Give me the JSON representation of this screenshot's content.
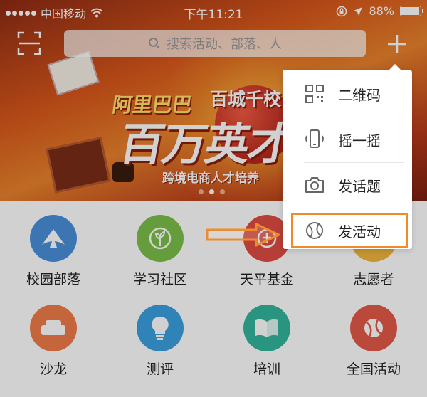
{
  "status_bar": {
    "carrier": "中国移动",
    "time": "下午11:21",
    "battery": "88%",
    "battery_level": 0.88
  },
  "search": {
    "placeholder": "搜索活动、部落、人"
  },
  "banner": {
    "line1": "阿里巴巴",
    "line2": "百城千校",
    "headline": "百万英才",
    "subline": "跨境电商人才培养",
    "page_count": 3,
    "active_page": 2
  },
  "grid": {
    "items": [
      {
        "label": "校园部落",
        "icon": "tent-icon",
        "color": "#4a90d9"
      },
      {
        "label": "学习社区",
        "icon": "sprout-icon",
        "color": "#7cc04b"
      },
      {
        "label": "天平基金",
        "icon": "fund-icon",
        "color": "#e04c43"
      },
      {
        "label": "志愿者",
        "icon": "volunteer-icon",
        "color": "#f0b63c"
      },
      {
        "label": "沙龙",
        "icon": "sofa-icon",
        "color": "#f07c4a"
      },
      {
        "label": "测评",
        "icon": "lightbulb-icon",
        "color": "#3aa0e0"
      },
      {
        "label": "培训",
        "icon": "book-icon",
        "color": "#33b59b"
      },
      {
        "label": "全国活动",
        "icon": "ball-icon",
        "color": "#e45a48"
      }
    ]
  },
  "menu": {
    "items": [
      {
        "label": "二维码",
        "icon": "qr-code-icon"
      },
      {
        "label": "摇一摇",
        "icon": "shake-phone-icon"
      },
      {
        "label": "发话题",
        "icon": "camera-icon"
      },
      {
        "label": "发活动",
        "icon": "ball-icon"
      }
    ]
  },
  "colors": {
    "highlight": "#f08b2b",
    "arrow": "#f08b2b"
  }
}
